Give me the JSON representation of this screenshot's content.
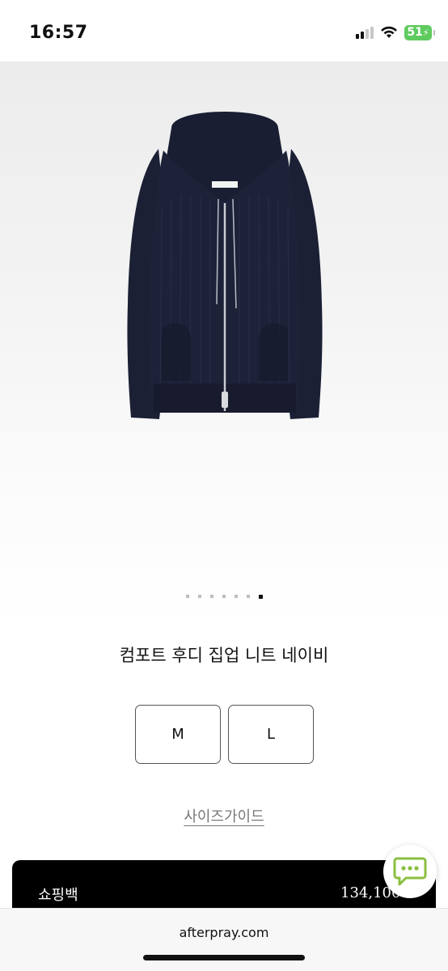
{
  "status_bar": {
    "time": "16:57",
    "battery": "51",
    "icons": [
      "signal-icon",
      "wifi-icon",
      "battery-charging-icon"
    ]
  },
  "product": {
    "image": "navy-knit-zip-hoodie",
    "carousel": {
      "total": 7,
      "active": 7
    },
    "title": "컴포트 후디 집업 니트 네이비",
    "sizes": [
      "M",
      "L"
    ],
    "size_guide": "사이즈가이드"
  },
  "cart": {
    "label": "쇼핑백",
    "price": "134,100"
  },
  "chat": {
    "icon": "chat-bubble-icon",
    "color": "#8bbf3f"
  },
  "browser": {
    "url": "afterpray.com"
  }
}
